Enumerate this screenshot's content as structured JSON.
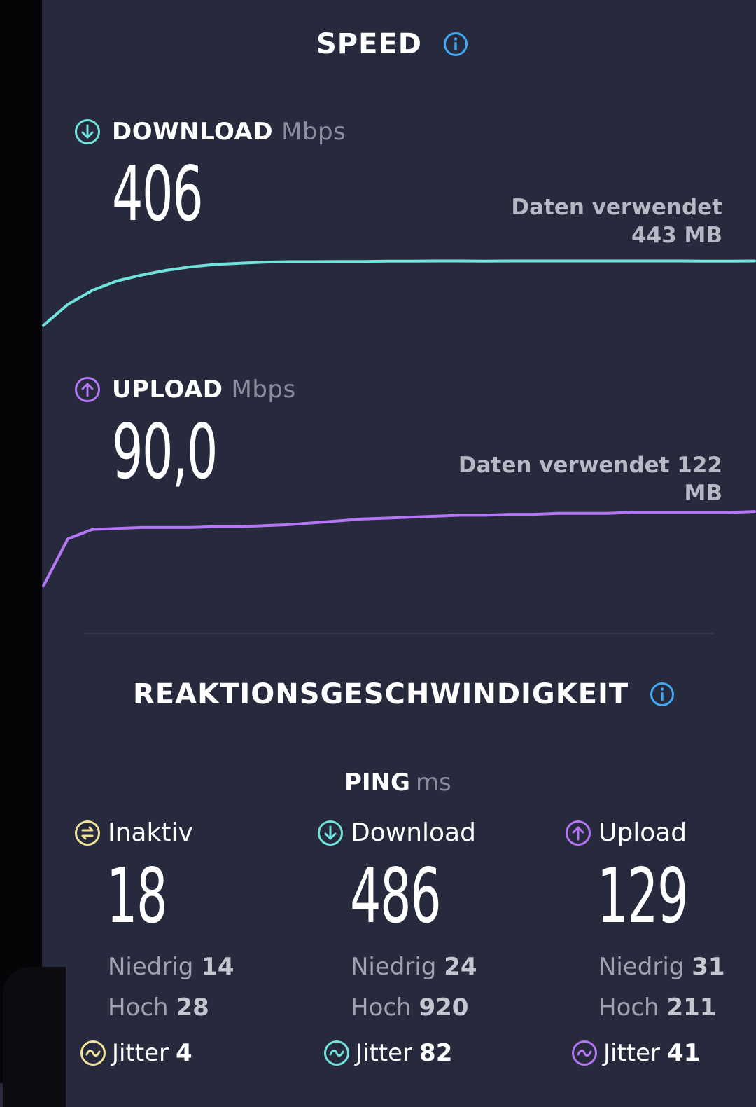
{
  "colors": {
    "background": "#262a3c",
    "download": "#6fe3dc",
    "upload": "#b476f5",
    "idle": "#f1e39a",
    "info": "#3fa9f5"
  },
  "speed": {
    "title": "SPEED",
    "info_icon": "info-icon",
    "download": {
      "label": "DOWNLOAD",
      "unit": "Mbps",
      "value": "406",
      "data_used_label": "Daten verwendet",
      "data_used_value": "443 MB",
      "icon": "arrow-down-circle-icon"
    },
    "upload": {
      "label": "UPLOAD",
      "unit": "Mbps",
      "value": "90,0",
      "data_used_line1": "Daten verwendet 122",
      "data_used_line2": "MB",
      "icon": "arrow-up-circle-icon"
    }
  },
  "chart_data": [
    {
      "type": "line",
      "series": [
        {
          "values": [
            40,
            130,
            190,
            230,
            255,
            275,
            290,
            300,
            305,
            310,
            312,
            312,
            313,
            313,
            314,
            314,
            315,
            315,
            314,
            315,
            315,
            315,
            315,
            315,
            315,
            315,
            315,
            314,
            314,
            315
          ]
        }
      ],
      "ylim": [
        0,
        406
      ],
      "grid": false
    },
    {
      "type": "line",
      "series": [
        {
          "values": [
            5,
            55,
            65,
            66,
            67,
            67,
            67,
            68,
            68,
            69,
            70,
            72,
            74,
            76,
            77,
            78,
            79,
            80,
            80,
            81,
            81,
            82,
            82,
            82,
            83,
            83,
            83,
            83,
            83,
            84
          ]
        }
      ],
      "ylim": [
        0,
        90
      ],
      "grid": false
    }
  ],
  "responsiveness": {
    "title": "REAKTIONSGESCHWINDIGKEIT",
    "info_icon": "info-icon",
    "ping_label": "PING",
    "ping_unit": "ms",
    "columns": [
      {
        "label": "Inaktiv",
        "value": "18",
        "low_label": "Niedrig",
        "low": "14",
        "high_label": "Hoch",
        "high": "28",
        "jitter_label": "Jitter",
        "jitter": "4",
        "icon": "idle-circle-icon",
        "jitter_icon": "jitter-wave-icon"
      },
      {
        "label": "Download",
        "value": "486",
        "low_label": "Niedrig",
        "low": "24",
        "high_label": "Hoch",
        "high": "920",
        "jitter_label": "Jitter",
        "jitter": "82",
        "icon": "arrow-down-circle-icon",
        "jitter_icon": "jitter-wave-icon"
      },
      {
        "label": "Upload",
        "value": "129",
        "low_label": "Niedrig",
        "low": "31",
        "high_label": "Hoch",
        "high": "211",
        "jitter_label": "Jitter",
        "jitter": "41",
        "icon": "arrow-up-circle-icon",
        "jitter_icon": "jitter-wave-icon"
      }
    ]
  }
}
